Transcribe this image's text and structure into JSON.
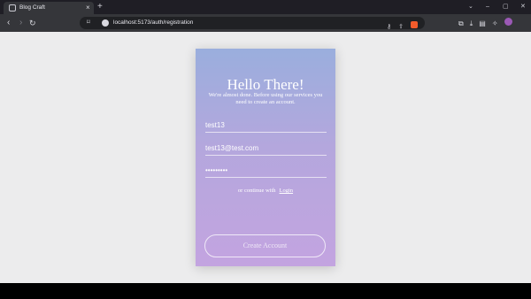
{
  "browser": {
    "tab_title": "Blog Craft",
    "url": "localhost:5173/auth/registration"
  },
  "form": {
    "title": "Hello There!",
    "subtitle": "We're almost done. Before using our services you need to create an account.",
    "username_value": "test13",
    "email_value": "test13@test.com",
    "password_value": "•••••••••",
    "login_prompt": "or continue with",
    "login_link": "Login",
    "submit_label": "Create Account"
  },
  "colors": {
    "page_background": "#ececed",
    "card_gradient_top": "#9aaedd",
    "card_gradient_bottom": "#c3a4e0",
    "text": "#ffffff"
  },
  "icons": {
    "back": "back-arrow-icon",
    "forward": "forward-arrow-icon",
    "reload": "reload-icon",
    "bookmark": "bookmark-icon",
    "site_info": "site-info-icon",
    "key": "key-icon",
    "share": "share-icon",
    "brave": "brave-shield-icon",
    "extensions": "extensions-icon",
    "downloads": "download-icon",
    "sidebar": "sidebar-icon",
    "leo": "ai-assistant-icon",
    "profile": "profile-avatar-icon"
  }
}
